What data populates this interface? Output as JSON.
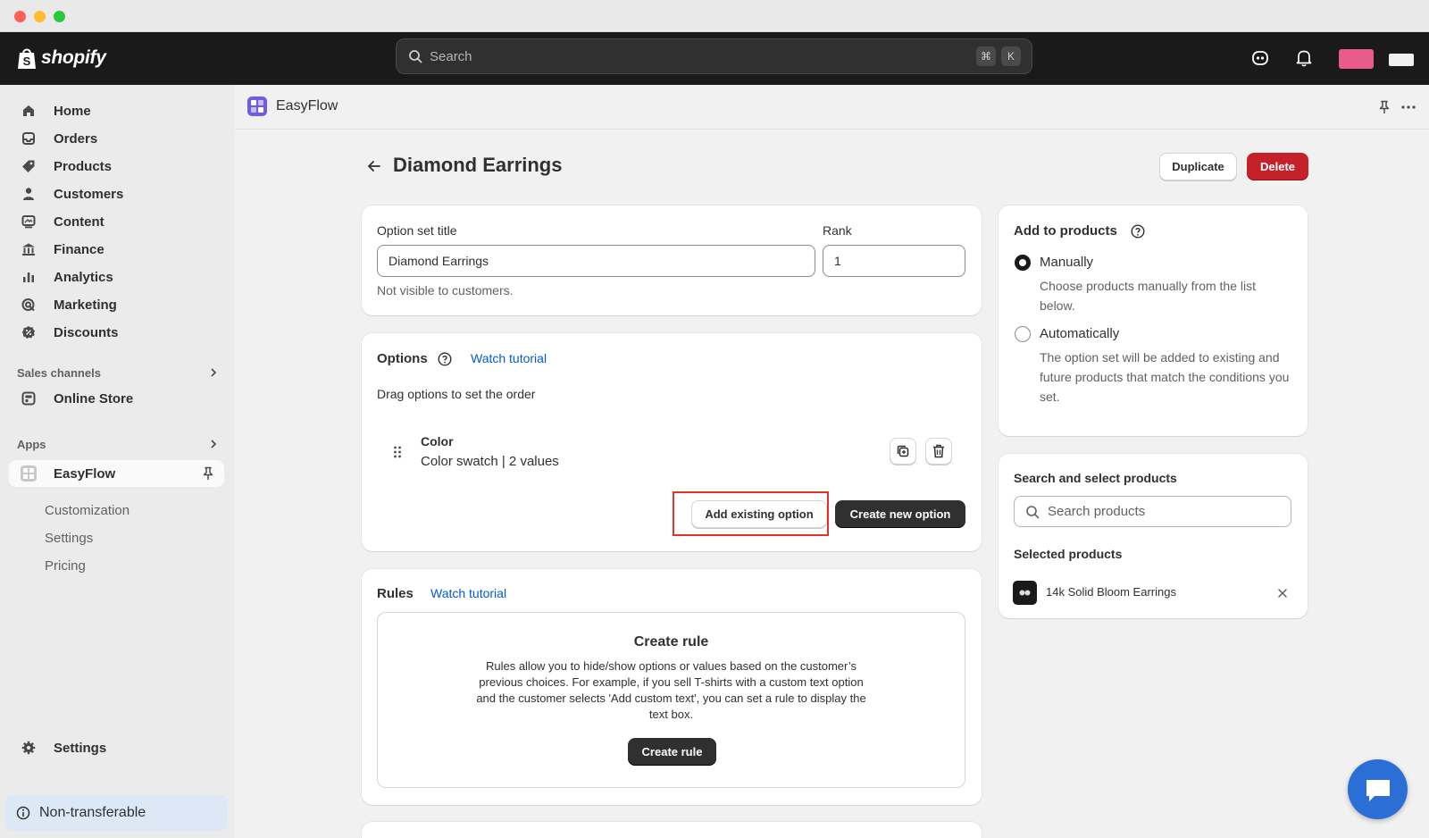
{
  "topbar": {
    "logo_text": "shopify",
    "search_placeholder": "Search",
    "shortcut_keys": [
      "⌘",
      "K"
    ]
  },
  "sidebar": {
    "items": [
      {
        "label": "Home",
        "icon": "home-icon"
      },
      {
        "label": "Orders",
        "icon": "orders-icon"
      },
      {
        "label": "Products",
        "icon": "tag-icon"
      },
      {
        "label": "Customers",
        "icon": "person-icon"
      },
      {
        "label": "Content",
        "icon": "content-icon"
      },
      {
        "label": "Finance",
        "icon": "bank-icon"
      },
      {
        "label": "Analytics",
        "icon": "bar-chart-icon"
      },
      {
        "label": "Marketing",
        "icon": "target-icon"
      },
      {
        "label": "Discounts",
        "icon": "discount-icon"
      }
    ],
    "sales_channels_label": "Sales channels",
    "online_store_label": "Online Store",
    "apps_label": "Apps",
    "app_item_label": "EasyFlow",
    "app_subitems": [
      "Customization",
      "Settings",
      "Pricing"
    ],
    "settings_label": "Settings",
    "nontransferable_label": "Non-transferable"
  },
  "app_header": {
    "name": "EasyFlow"
  },
  "page": {
    "title": "Diamond Earrings",
    "duplicate_label": "Duplicate",
    "delete_label": "Delete"
  },
  "option_set": {
    "title_label": "Option set title",
    "title_value": "Diamond Earrings",
    "rank_label": "Rank",
    "rank_value": "1",
    "help_text": "Not visible to customers."
  },
  "options": {
    "heading": "Options",
    "watch_tutorial": "Watch tutorial",
    "drag_hint": "Drag options to set the order",
    "item_name": "Color",
    "item_meta": "Color swatch | 2 values",
    "add_existing_label": "Add existing option",
    "create_new_label": "Create new option"
  },
  "rules": {
    "heading": "Rules",
    "watch_tutorial": "Watch tutorial",
    "box_title": "Create rule",
    "box_desc": "Rules allow you to hide/show options or values based on the customer’s previous choices. For example, if you sell T-shirts with a custom text option and the customer selects 'Add custom text', you can set a rule to display the text box.",
    "create_rule_label": "Create rule"
  },
  "add_to_products": {
    "heading": "Add to products",
    "manual_label": "Manually",
    "manual_desc": "Choose products manually from the list below.",
    "auto_label": "Automatically",
    "auto_desc": "The option set will be added to existing and future products that match the conditions you set."
  },
  "product_search": {
    "heading": "Search and select products",
    "placeholder": "Search products",
    "selected_heading": "Selected products",
    "selected_items": [
      "14k Solid Bloom Earrings"
    ]
  },
  "colors": {
    "accent_link": "#005bd3",
    "danger": "#c4212b",
    "highlight": "#e0342a"
  }
}
